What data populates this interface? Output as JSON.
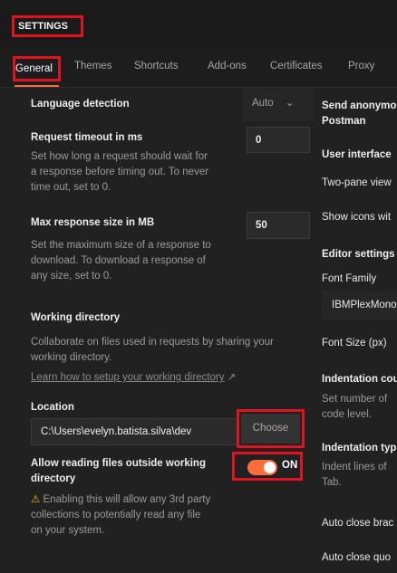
{
  "header": {
    "title": "SETTINGS"
  },
  "tabs": [
    "General",
    "Themes",
    "Shortcuts",
    "Add-ons",
    "Certificates",
    "Proxy"
  ],
  "general": {
    "language_detection": {
      "label": "Language detection",
      "value": "Auto"
    },
    "request_timeout": {
      "label": "Request timeout in ms",
      "value": "0",
      "help": [
        "Set how long a request should wait for",
        "a response before timing out. To never",
        "time out, set to 0."
      ]
    },
    "max_response": {
      "label": "Max response size in MB",
      "value": "50",
      "help": [
        "Set the maximum size of a response to",
        "download. To download a response of",
        "any size, set to 0."
      ]
    },
    "working_directory": {
      "label": "Working directory",
      "help": [
        "Collaborate on files used in requests by sharing your",
        "working directory."
      ],
      "link": "Learn how to setup your working directory",
      "location_label": "Location",
      "location_value": "C:\\Users\\evelyn.batista.silva\\dev",
      "choose_label": "Choose"
    },
    "allow_outside": {
      "label_lines": [
        "Allow reading files outside working",
        "directory"
      ],
      "toggle_label": "ON",
      "warning_lines": [
        "Enabling this will allow any 3rd party",
        "collections to potentially read any file",
        "on your system."
      ]
    }
  },
  "right_panel": {
    "send_anonymous": [
      "Send anonymo",
      "Postman"
    ],
    "user_interface": "User interface",
    "two_pane": "Two-pane view",
    "show_icons": "Show icons wit",
    "editor_settings": "Editor settings",
    "font_family": "Font Family",
    "font_family_value": "IBMPlexMono",
    "font_size": "Font Size (px)",
    "indentation_count": "Indentation cou",
    "indentation_count_help": [
      "Set number of",
      "code level."
    ],
    "indentation_type": "Indentation typ",
    "indentation_type_help": [
      "Indent lines of",
      "Tab."
    ],
    "auto_close_brackets": "Auto close brac",
    "auto_close_quotes": "Auto close quo"
  },
  "colors": {
    "accent": "#ff6c37",
    "annotation": "#e0141e",
    "background": "#212121"
  }
}
